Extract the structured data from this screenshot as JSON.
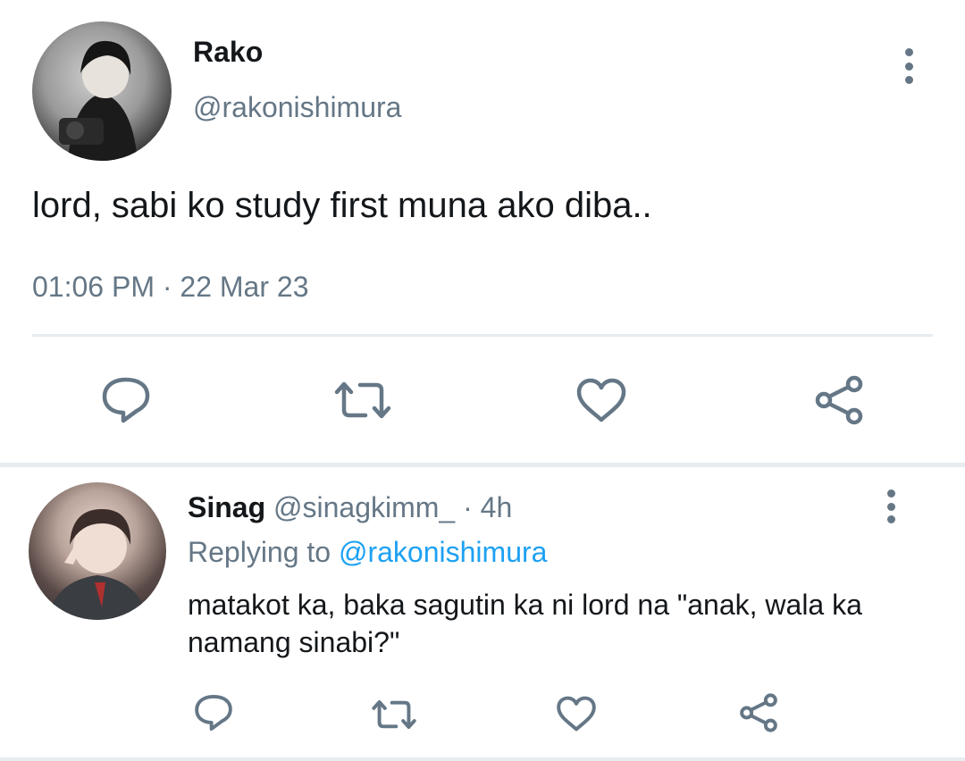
{
  "main_tweet": {
    "display_name": "Rako",
    "handle": "@rakonishimura",
    "text": "lord, sabi ko study first muna ako diba..",
    "time": "01:06 PM",
    "separator": "·",
    "date": "22 Mar 23"
  },
  "reply": {
    "display_name": "Sinag",
    "handle": "@sinagkimm_",
    "separator": "·",
    "time_ago": "4h",
    "replying_to_label": "Replying to",
    "replying_to_handle": "@rakonishimura",
    "text": "matakot ka, baka sagutin ka ni lord na \"anak, wala ka namang sinabi?\""
  },
  "icons": {
    "reply": "comment-bubble-icon",
    "retweet": "retweet-icon",
    "like": "heart-icon",
    "share": "share-icon",
    "more": "more-vertical-icon"
  },
  "colors": {
    "text": "#14171a",
    "secondary": "#657786",
    "link": "#1da1f2",
    "divider": "#e6ecf0"
  }
}
